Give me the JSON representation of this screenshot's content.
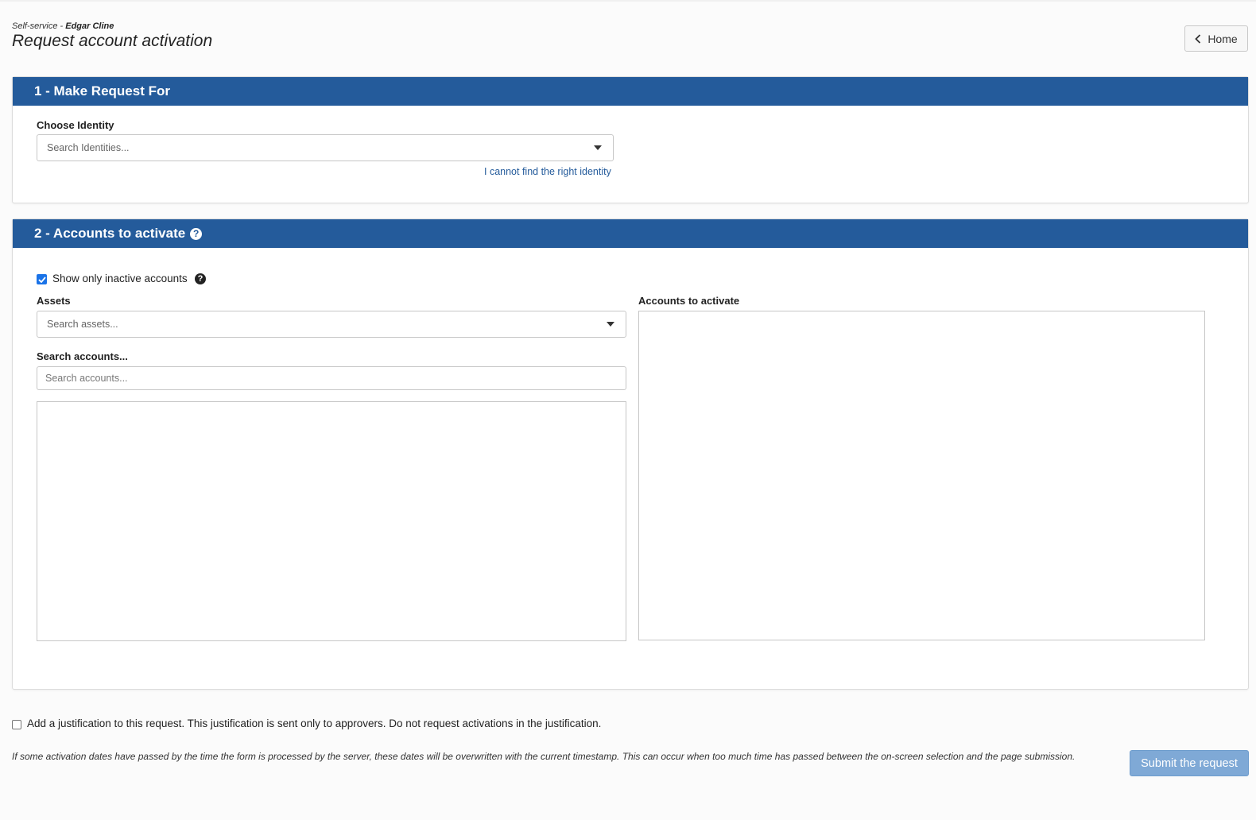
{
  "header": {
    "breadcrumb_prefix": "Self-service - ",
    "breadcrumb_user": "Edgar Cline",
    "title": "Request account activation",
    "home_label": "Home"
  },
  "section1": {
    "title": "1 - Make Request For",
    "identity_label": "Choose Identity",
    "identity_placeholder": "Search Identities...",
    "cannot_find_link": "I cannot find the right identity"
  },
  "section2": {
    "title": "2 - Accounts to activate",
    "show_inactive_label": "Show only inactive accounts",
    "show_inactive_checked": true,
    "assets_label": "Assets",
    "assets_placeholder": "Search assets...",
    "search_accounts_label": "Search accounts...",
    "search_accounts_placeholder": "Search accounts...",
    "accounts_to_activate_label": "Accounts to activate"
  },
  "justification": {
    "label": "Add a justification to this request. This justification is sent only to approvers. Do not request activations in the justification.",
    "checked": false
  },
  "footer": {
    "note": "If some activation dates have passed by the time the form is processed by the server, these dates will be overwritten with the current timestamp. This can occur when too much time has passed between the on-screen selection and the page submission.",
    "submit_label": "Submit the request"
  },
  "colors": {
    "panel_header": "#245b9b",
    "link": "#245b9b",
    "submit_disabled": "#7fa9d6",
    "checkbox": "#1a73e8"
  }
}
